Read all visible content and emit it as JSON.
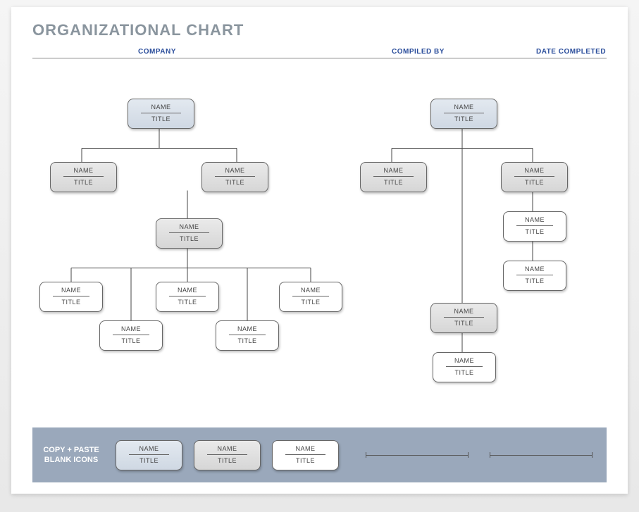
{
  "title": "ORGANIZATIONAL CHART",
  "headers": {
    "company": "COMPANY",
    "compiled": "COMPILED BY",
    "date": "DATE COMPLETED"
  },
  "node_labels": {
    "name": "NAME",
    "title": "TITLE"
  },
  "footer_label_line1": "COPY + PASTE",
  "footer_label_line2": "BLANK ICONS",
  "left_tree": {
    "root": {
      "name": "NAME",
      "title": "TITLE"
    },
    "level2": [
      {
        "name": "NAME",
        "title": "TITLE"
      },
      {
        "name": "NAME",
        "title": "TITLE"
      }
    ],
    "level3": {
      "name": "NAME",
      "title": "TITLE"
    },
    "level4_top": [
      {
        "name": "NAME",
        "title": "TITLE"
      },
      {
        "name": "NAME",
        "title": "TITLE"
      },
      {
        "name": "NAME",
        "title": "TITLE"
      }
    ],
    "level4_bottom": [
      {
        "name": "NAME",
        "title": "TITLE"
      },
      {
        "name": "NAME",
        "title": "TITLE"
      }
    ]
  },
  "right_tree": {
    "root": {
      "name": "NAME",
      "title": "TITLE"
    },
    "level2": [
      {
        "name": "NAME",
        "title": "TITLE"
      },
      {
        "name": "NAME",
        "title": "TITLE"
      }
    ],
    "chain": [
      {
        "name": "NAME",
        "title": "TITLE"
      },
      {
        "name": "NAME",
        "title": "TITLE"
      }
    ],
    "branch_mid": {
      "name": "NAME",
      "title": "TITLE"
    },
    "branch_bottom": {
      "name": "NAME",
      "title": "TITLE"
    }
  },
  "palette": [
    {
      "style": "blue",
      "name": "NAME",
      "title": "TITLE"
    },
    {
      "style": "gray",
      "name": "NAME",
      "title": "TITLE"
    },
    {
      "style": "white",
      "name": "NAME",
      "title": "TITLE"
    }
  ]
}
